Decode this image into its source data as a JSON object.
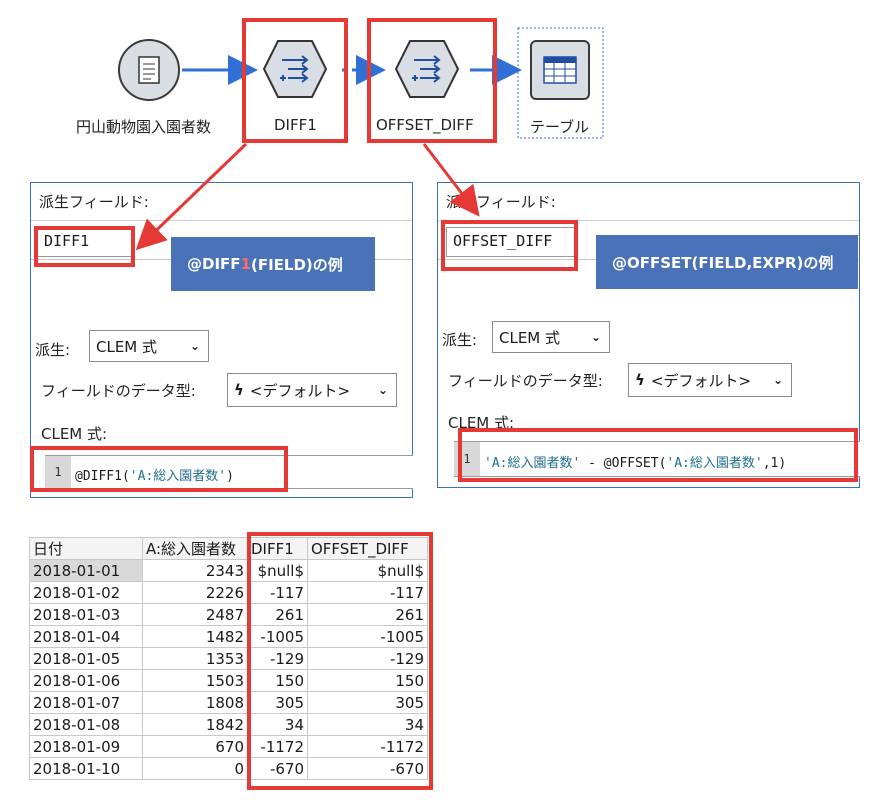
{
  "flow": {
    "source_label": "円山動物園入園者数",
    "node1_label": "DIFF1",
    "node2_label": "OFFSET_DIFF",
    "table_label": "テーブル"
  },
  "left_dialog": {
    "header": "派生フィールド:",
    "field_name": "DIFF1",
    "callout_prefix": "@DIFF",
    "callout_accent": "1",
    "callout_suffix": "(FIELD)の例",
    "derive_label": "派生:",
    "derive_value": "CLEM 式",
    "dtype_label": "フィールドのデータ型:",
    "dtype_value": "<デフォルト>",
    "clem_label": "CLEM 式:",
    "line_no": "1",
    "code_func": "@DIFF1(",
    "code_str": "'A:総入園者数'",
    "code_end": ")"
  },
  "right_dialog": {
    "header": "派生フィールド:",
    "field_name": "OFFSET_DIFF",
    "callout": "@OFFSET(FIELD,EXPR)の例",
    "derive_label": "派生:",
    "derive_value": "CLEM 式",
    "dtype_label": "フィールドのデータ型:",
    "dtype_value": "<デフォルト>",
    "clem_label": "CLEM 式:",
    "line_no": "1",
    "code_str1": "'A:総入園者数'",
    "code_mid": " - @OFFSET(",
    "code_str2": "'A:総入園者数'",
    "code_end": ",1)"
  },
  "table": {
    "headers": [
      "日付",
      "A:総入園者数",
      "DIFF1",
      "OFFSET_DIFF"
    ],
    "rows": [
      [
        "2018-01-01",
        "2343",
        "$null$",
        "$null$"
      ],
      [
        "2018-01-02",
        "2226",
        "-117",
        "-117"
      ],
      [
        "2018-01-03",
        "2487",
        "261",
        "261"
      ],
      [
        "2018-01-04",
        "1482",
        "-1005",
        "-1005"
      ],
      [
        "2018-01-05",
        "1353",
        "-129",
        "-129"
      ],
      [
        "2018-01-06",
        "1503",
        "150",
        "150"
      ],
      [
        "2018-01-07",
        "1808",
        "305",
        "305"
      ],
      [
        "2018-01-08",
        "1842",
        "34",
        "34"
      ],
      [
        "2018-01-09",
        "670",
        "-1172",
        "-1172"
      ],
      [
        "2018-01-10",
        "0",
        "-670",
        "-670"
      ]
    ]
  },
  "colors": {
    "highlight": "#e53935",
    "callout": "#4a72b8",
    "flow_arrow": "#2f6fd6"
  }
}
